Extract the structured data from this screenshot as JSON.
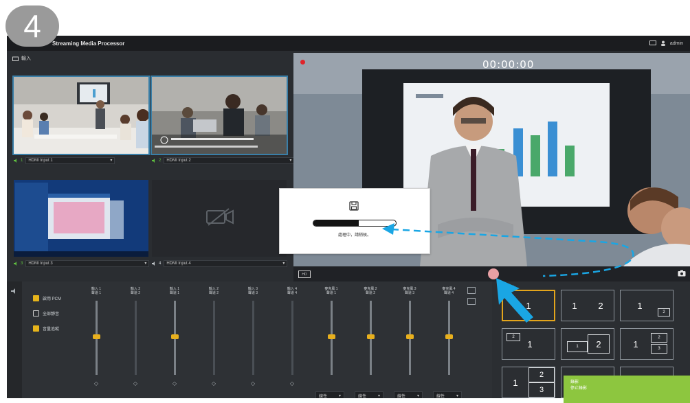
{
  "step_badge": "4",
  "title_bar": {
    "app_title": "Streaming Media Processor",
    "user": "admin"
  },
  "inputs": {
    "section_label": "輸入",
    "sources": [
      {
        "number": "1",
        "name": "HDMI Input 1"
      },
      {
        "number": "2",
        "name": "HDMI Input 2"
      },
      {
        "number": "3",
        "name": "HDMI Input 3"
      },
      {
        "number": "4",
        "name": "HDMI Input 4"
      }
    ]
  },
  "preview": {
    "timer": "00:00:00",
    "hd_chip": "HD"
  },
  "saving_dialog": {
    "icon": "floppy-disk-icon",
    "progress": 0.55,
    "message": "處理中，請稍候。"
  },
  "mixer": {
    "options": [
      {
        "label": "啟用 PCM",
        "checked": true
      },
      {
        "label": "全部靜音",
        "checked": false
      },
      {
        "label": "音量追蹤",
        "checked": true
      }
    ],
    "faders": [
      {
        "label1": "輸入 1",
        "label2": "聲道 1"
      },
      {
        "label1": "輸入 2",
        "label2": "聲道 2"
      },
      {
        "label1": "輸入 1",
        "label2": "聲道 1"
      },
      {
        "label1": "輸入 2",
        "label2": "聲道 2"
      },
      {
        "label1": "輸入 3",
        "label2": "聲道 3"
      },
      {
        "label1": "輸入 4",
        "label2": "聲道 4"
      },
      {
        "label1": "麥克風 1",
        "label2": "聲道 1"
      },
      {
        "label1": "麥克風 2",
        "label2": "聲道 2"
      },
      {
        "label1": "麥克風 3",
        "label2": "聲道 3"
      },
      {
        "label1": "麥克風 4",
        "label2": "聲道 4"
      }
    ],
    "mode_selects": [
      "線性",
      "線性",
      "線性",
      "線性"
    ]
  },
  "layouts": {
    "l1": "1",
    "l2a": "1",
    "l2b": "2",
    "l3a": "1",
    "l3b": "2",
    "l4a": "2",
    "l4b": "1",
    "l5a": "1",
    "l5b": "2",
    "l6a": "1",
    "l6b": "2",
    "l6c": "3",
    "l7a": "1",
    "l7b": "2",
    "l7c": "3",
    "l8a": "1",
    "l8b": "2"
  },
  "toast": {
    "line1": "錄影",
    "line2": "停止錄影"
  },
  "colors": {
    "accent": "#e6b41b",
    "selection": "#3a7fa8",
    "toast": "#8dc63f",
    "record": "#e0242a",
    "arrow": "#1aa6e4"
  }
}
